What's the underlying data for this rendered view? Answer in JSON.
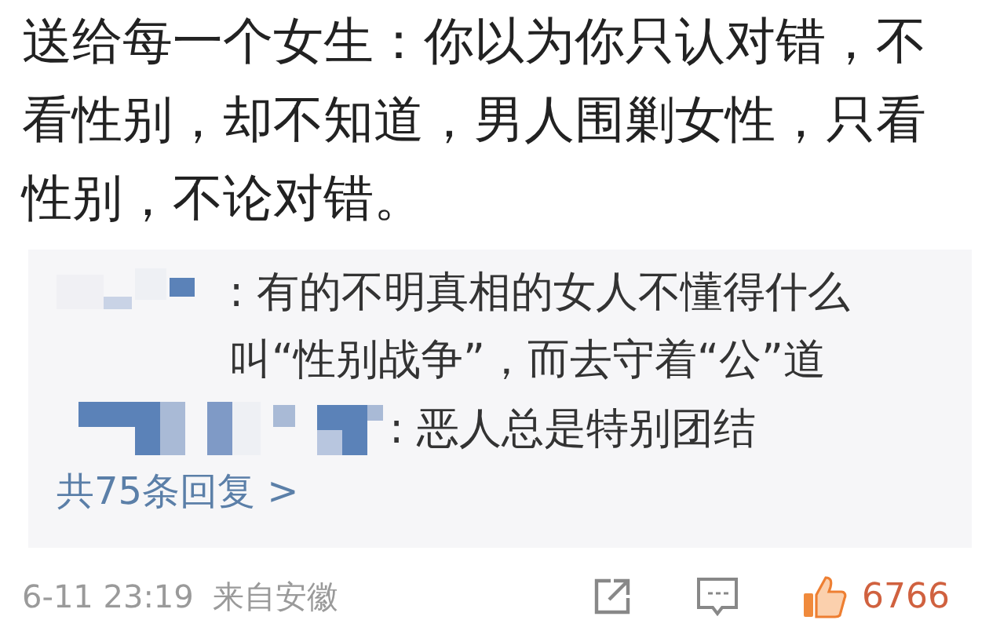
{
  "post": {
    "text": "送给每一个女生：你以为你只认对错，不看性别，却不知道，男人围剿女性，只看性别，不论对错。"
  },
  "comments": [
    {
      "text": ": 有的不明真相的女人不懂得什么叫“性别战争”，而去守着“公”道"
    },
    {
      "text": ": 恶人总是特别团结"
    }
  ],
  "more_replies": "共75条回复 >",
  "footer": {
    "date": "6-11 23:19",
    "source": "来自安徽",
    "likes": "6766"
  }
}
